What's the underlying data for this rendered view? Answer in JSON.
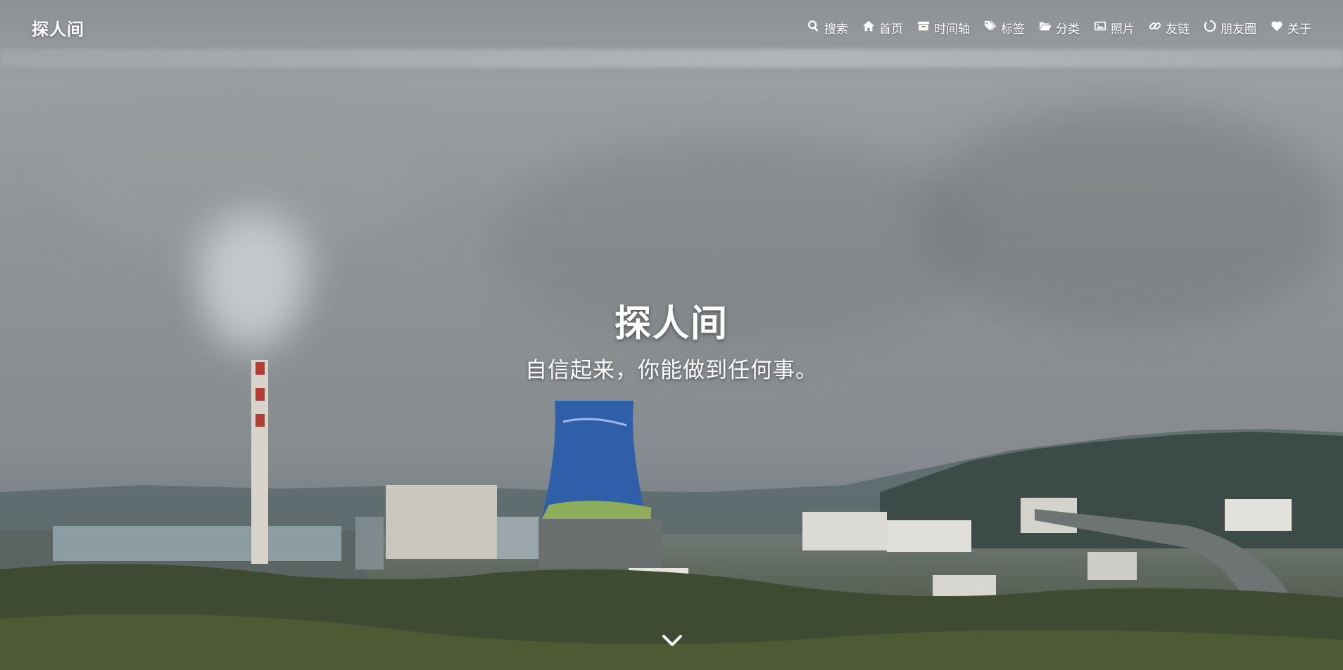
{
  "navbar": {
    "brand": "探人间",
    "menu": [
      {
        "label": "搜索",
        "icon": "search-icon"
      },
      {
        "label": "首页",
        "icon": "home-icon"
      },
      {
        "label": "时间轴",
        "icon": "archive-icon"
      },
      {
        "label": "标签",
        "icon": "tags-icon"
      },
      {
        "label": "分类",
        "icon": "folder-open-icon"
      },
      {
        "label": "照片",
        "icon": "image-icon"
      },
      {
        "label": "友链",
        "icon": "link-icon"
      },
      {
        "label": "朋友圈",
        "icon": "circle-notch-icon"
      },
      {
        "label": "关于",
        "icon": "heart-icon"
      }
    ]
  },
  "hero": {
    "title": "探人间",
    "subtitle": "自信起来，你能做到任何事。",
    "scroll_icon": "chevron-down-icon"
  },
  "colors": {
    "text": "#ffffff",
    "sky": "#8f9497",
    "hills": "#3c4a48",
    "tower_blue": "#2f5fa8"
  }
}
